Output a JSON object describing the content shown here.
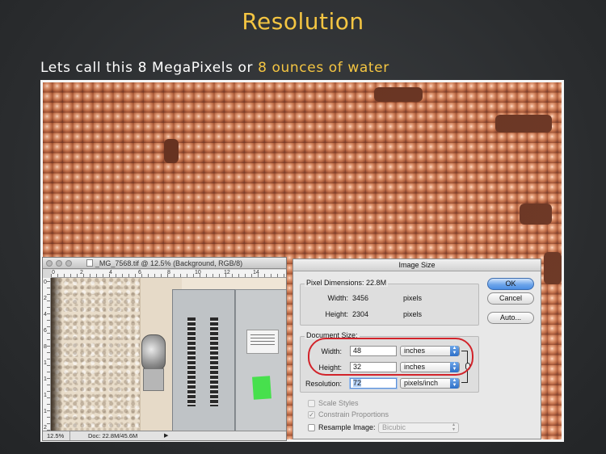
{
  "slide": {
    "title": "Resolution",
    "subtitle_prefix": "Lets call this 8 MegaPixels or ",
    "subtitle_highlight": "8 ounces of water",
    "accent_color": "#f4c542"
  },
  "ps_window": {
    "title": "_MG_7568.tif @ 12.5% (Background, RGB/8)",
    "zoom": "12.5%",
    "doc_info": "Doc: 22.8M/45.6M",
    "ruler_top": [
      "0",
      "2",
      "4",
      "6",
      "8",
      "10",
      "12",
      "14"
    ],
    "ruler_left": [
      "0",
      "2",
      "4",
      "6",
      "8",
      "1",
      "1",
      "1",
      "1",
      "2"
    ]
  },
  "dialog": {
    "title": "Image Size",
    "pixel_dimensions_label": "Pixel Dimensions:",
    "pixel_dimensions_value": "22.8M",
    "px_width_label": "Width:",
    "px_width_value": "3456",
    "px_width_unit": "pixels",
    "px_height_label": "Height:",
    "px_height_value": "2304",
    "px_height_unit": "pixels",
    "document_size_label": "Document Size:",
    "doc_width_label": "Width:",
    "doc_width_value": "48",
    "doc_width_unit": "inches",
    "doc_height_label": "Height:",
    "doc_height_value": "32",
    "doc_height_unit": "inches",
    "resolution_label": "Resolution:",
    "resolution_value": "72",
    "resolution_unit": "pixels/inch",
    "scale_styles_label": "Scale Styles",
    "constrain_label": "Constrain Proportions",
    "resample_label": "Resample Image:",
    "resample_value": "Bicubic",
    "ok_label": "OK",
    "cancel_label": "Cancel",
    "auto_label": "Auto..."
  }
}
